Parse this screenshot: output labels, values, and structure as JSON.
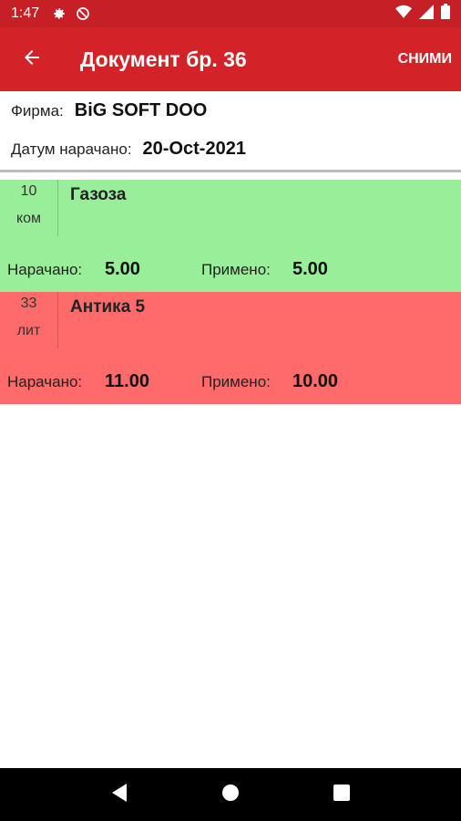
{
  "status_bar": {
    "time": "1:47",
    "icons": [
      "gear-icon",
      "do-not-disturb-icon",
      "wifi-icon",
      "signal-icon",
      "battery-icon"
    ]
  },
  "app_bar": {
    "back_icon": "arrow-left-icon",
    "title": "Документ бр. 36",
    "action_label": "СНИМИ",
    "color": "#d32228"
  },
  "header": {
    "company_label": "Фирма:",
    "company_value": "BiG SOFT DOO",
    "date_label": "Датум нарачано:",
    "date_value": "20-Oct-2021"
  },
  "items": [
    {
      "qty": "10",
      "unit": "ком",
      "name": "Газоза",
      "ordered_label": "Нарачано:",
      "ordered_value": "5.00",
      "received_label": "Примено:",
      "received_value": "5.00",
      "status_color": "#98ee99"
    },
    {
      "qty": "33",
      "unit": "лит",
      "name": "Антика 5",
      "ordered_label": "Нарачано:",
      "ordered_value": "11.00",
      "received_label": "Примено:",
      "received_value": "10.00",
      "status_color": "#ff6b6b"
    }
  ],
  "nav_bar": {
    "icons": [
      "back-triangle-icon",
      "home-circle-icon",
      "recents-square-icon"
    ]
  }
}
